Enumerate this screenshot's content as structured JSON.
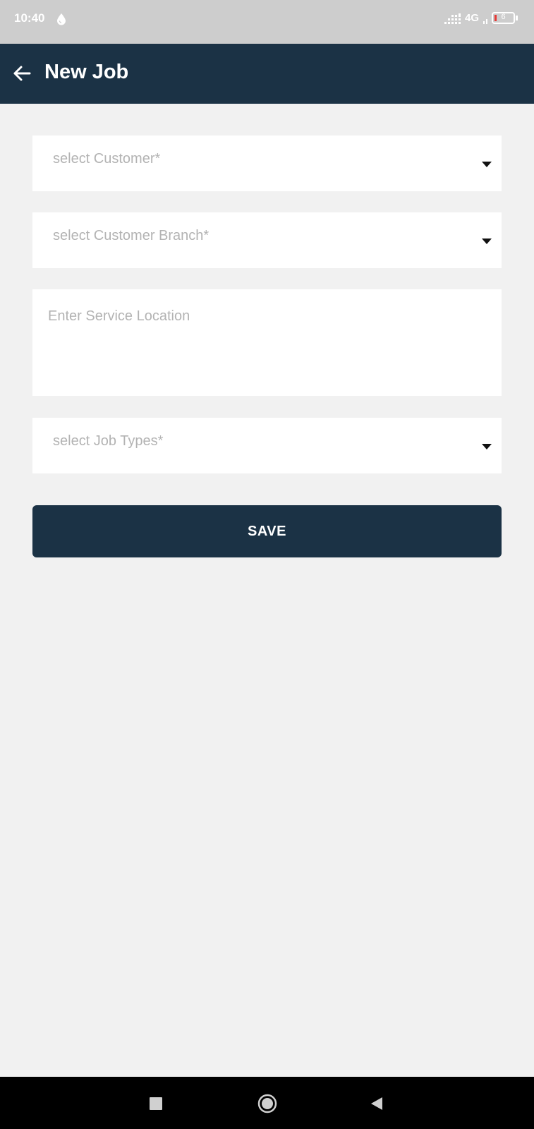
{
  "status_bar": {
    "time": "10:40",
    "network": "4G",
    "battery_level": "6",
    "icons": [
      "droplet-icon",
      "signal-icon",
      "battery-icon"
    ]
  },
  "app_bar": {
    "title": "New Job",
    "back_icon": "arrow-left-icon"
  },
  "form": {
    "customer": {
      "placeholder": "select Customer*"
    },
    "customer_branch": {
      "placeholder": "select Customer Branch*"
    },
    "service_location": {
      "placeholder": "Enter Service Location"
    },
    "job_types": {
      "placeholder": "select Job Types*"
    },
    "save_label": "SAVE"
  },
  "nav_bar": {
    "icons": [
      "square-recents-icon",
      "circle-home-icon",
      "triangle-back-icon"
    ]
  },
  "colors": {
    "primary": "#1b3245",
    "background": "#f1f1f1",
    "field": "#ffffff",
    "placeholder": "#b3b3b3",
    "status_bar": "#cdcdcd",
    "battery_low": "#e53935"
  }
}
